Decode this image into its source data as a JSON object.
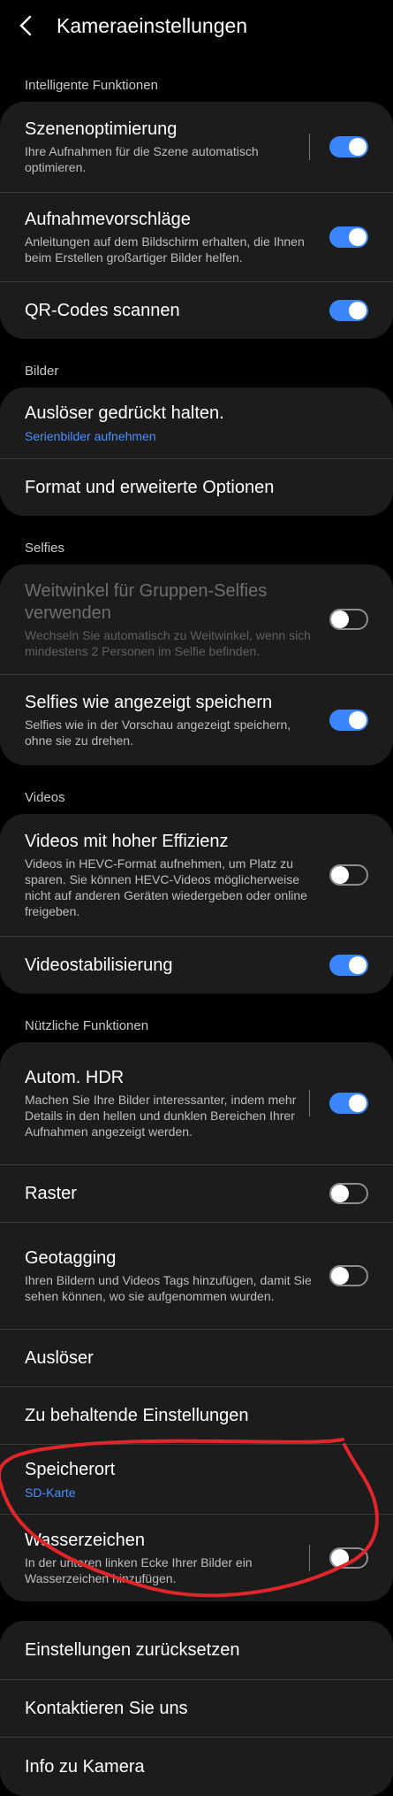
{
  "header": {
    "title": "Kameraeinstellungen",
    "back_icon": "arrow-left-icon"
  },
  "sections": {
    "intelligent": "Intelligente Funktionen",
    "images": "Bilder",
    "selfies": "Selfies",
    "videos": "Videos",
    "useful": "Nützliche Funktionen"
  },
  "items": {
    "scene": {
      "title": "Szenenoptimierung",
      "desc": "Ihre Aufnahmen für die Szene automatisch optimieren.",
      "toggle": "on"
    },
    "suggestions": {
      "title": "Aufnahmevorschläge",
      "desc": "Anleitungen auf dem Bildschirm erhalten, die Ihnen beim Erstellen großartiger Bilder helfen.",
      "toggle": "on"
    },
    "qr": {
      "title": "QR-Codes scannen",
      "toggle": "on"
    },
    "shutter_hold": {
      "title": "Auslöser gedrückt halten.",
      "value": "Serienbilder aufnehmen"
    },
    "format": {
      "title": "Format und erweiterte Optionen"
    },
    "wide_selfie": {
      "title": "Weitwinkel für Gruppen-Selfies verwenden",
      "desc": "Wechseln Sie automatisch zu Weitwinkel, wenn sich mindestens 2 Personen im Selfie befinden.",
      "toggle": "off"
    },
    "save_selfies": {
      "title": "Selfies wie angezeigt speichern",
      "desc": "Selfies wie in der Vorschau angezeigt speichern, ohne sie zu drehen.",
      "toggle": "on"
    },
    "hevc": {
      "title": "Videos mit hoher Effizienz",
      "desc": "Videos in HEVC-Format aufnehmen, um Platz zu sparen. Sie können HEVC-Videos möglicherweise nicht auf anderen Geräten wiedergeben oder online freigeben.",
      "toggle": "off"
    },
    "stabilization": {
      "title": "Videostabilisierung",
      "toggle": "on"
    },
    "hdr": {
      "title": "Autom. HDR",
      "desc": "Machen Sie Ihre Bilder interessanter, indem mehr Details in den hellen und dunklen Bereichen Ihrer Aufnahmen angezeigt werden.",
      "toggle": "on"
    },
    "grid": {
      "title": "Raster",
      "toggle": "off"
    },
    "geotag": {
      "title": "Geotagging",
      "desc": "Ihren Bildern und Videos Tags hinzufügen, damit Sie sehen können, wo sie aufgenommen wurden.",
      "toggle": "off"
    },
    "shutter": {
      "title": "Auslöser"
    },
    "keep_settings": {
      "title": "Zu behaltende Einstellungen"
    },
    "storage": {
      "title": "Speicherort",
      "value": "SD-Karte"
    },
    "watermark": {
      "title": "Wasserzeichen",
      "desc": "In der unteren linken Ecke Ihrer Bilder ein Wasserzeichen hinzufügen.",
      "toggle": "off"
    },
    "reset": {
      "title": "Einstellungen zurücksetzen"
    },
    "contact": {
      "title": "Kontaktieren Sie uns"
    },
    "about": {
      "title": "Info zu Kamera"
    }
  },
  "colors": {
    "accent": "#3b86ff",
    "link": "#4a90ff",
    "annotation": "#e0262a",
    "card": "#1c1c1c",
    "background": "#000000"
  }
}
